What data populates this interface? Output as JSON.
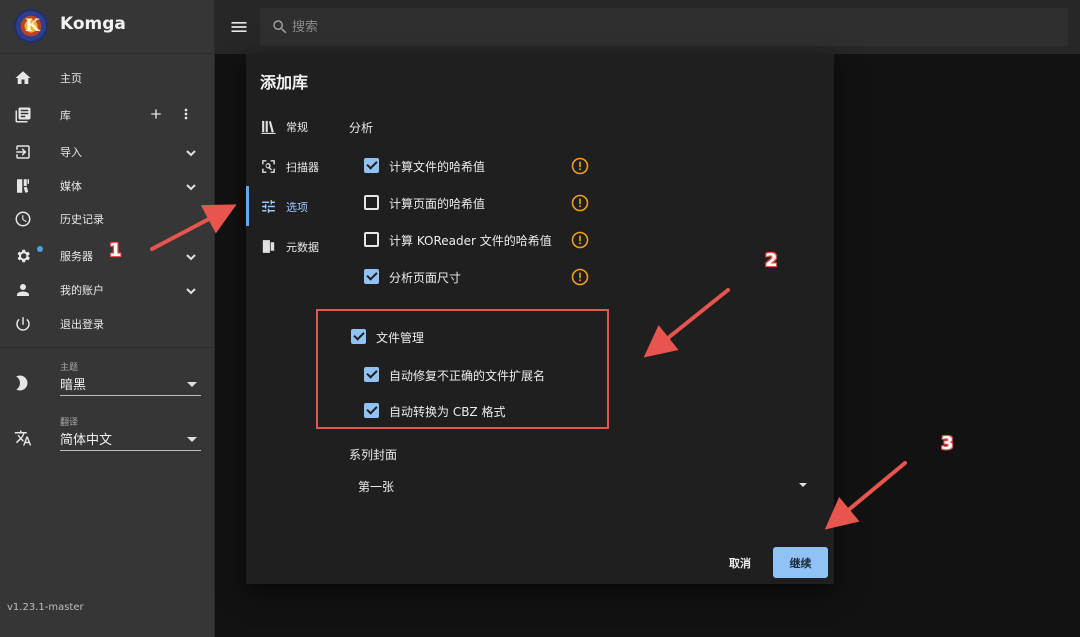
{
  "app": {
    "name": "Komga",
    "version": "v1.23.1-master"
  },
  "sidebar": {
    "items": [
      {
        "label": "主页",
        "icon": "home-icon"
      },
      {
        "label": "库",
        "icon": "library-icon"
      },
      {
        "label": "导入",
        "icon": "import-icon"
      },
      {
        "label": "媒体",
        "icon": "media-icon"
      },
      {
        "label": "历史记录",
        "icon": "history-icon"
      },
      {
        "label": "服务器",
        "icon": "gear-icon"
      },
      {
        "label": "我的账户",
        "icon": "account-icon"
      },
      {
        "label": "退出登录",
        "icon": "power-icon"
      }
    ],
    "theme": {
      "caption": "主题",
      "value": "暗黑"
    },
    "translation": {
      "caption": "翻译",
      "value": "简体中文"
    }
  },
  "topbar": {
    "search_placeholder": "搜索"
  },
  "dialog": {
    "title": "添加库",
    "tabs": [
      {
        "label": "常规",
        "icon": "books-icon"
      },
      {
        "label": "扫描器",
        "icon": "scanner-icon"
      },
      {
        "label": "选项",
        "icon": "tune-icon"
      },
      {
        "label": "元数据",
        "icon": "metadata-icon"
      }
    ],
    "active_tab": "选项",
    "analysis": {
      "title": "分析",
      "options": [
        {
          "label": "计算文件的哈希值",
          "checked": true
        },
        {
          "label": "计算页面的哈希值",
          "checked": false
        },
        {
          "label": "计算 KOReader 文件的哈希值",
          "checked": false
        },
        {
          "label": "分析页面尺寸",
          "checked": true
        }
      ]
    },
    "file_management": {
      "label": "文件管理",
      "checked": true,
      "options": [
        {
          "label": "自动修复不正确的文件扩展名",
          "checked": true
        },
        {
          "label": "自动转换为 CBZ 格式",
          "checked": true
        }
      ]
    },
    "series_cover": {
      "title": "系列封面",
      "value": "第一张"
    },
    "buttons": {
      "cancel": "取消",
      "continue": "继续"
    }
  },
  "annotations": {
    "steps": [
      "1",
      "2",
      "3"
    ]
  },
  "colors": {
    "accent": "#90c2f5",
    "warning": "#f0a020",
    "annotation": "#e8554e"
  }
}
